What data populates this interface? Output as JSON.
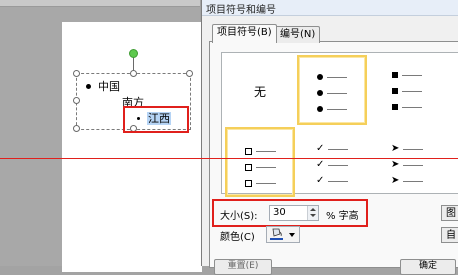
{
  "slide": {
    "bullets": [
      {
        "text": "中国",
        "level": 1
      },
      {
        "text": "南方",
        "level": 2
      },
      {
        "text": "江西",
        "level": 3
      }
    ]
  },
  "dialog": {
    "title": "项目符号和编号",
    "tabs": [
      {
        "label": "项目符号(B)",
        "active": true
      },
      {
        "label": "编号(N)",
        "active": false
      }
    ],
    "gallery": {
      "none_label": "无",
      "selected_cell": "filled-circle",
      "highlighted_cell": "hollow-square",
      "cells": [
        "none",
        "filled-circle",
        "filled-square",
        "hollow-square",
        "checkmark",
        "arrowhead"
      ]
    },
    "size": {
      "label": "大小(S):",
      "value": "30",
      "unit": "% 字高"
    },
    "color": {
      "label": "颜色(C)",
      "value": "#1e4fb4"
    },
    "side_buttons": [
      "图",
      "自"
    ],
    "bottom_buttons": [
      "重置(E)",
      "确定"
    ]
  },
  "colors": {
    "annotation_red": "#e0201c",
    "selection_yellow": "#f5cf5a"
  }
}
